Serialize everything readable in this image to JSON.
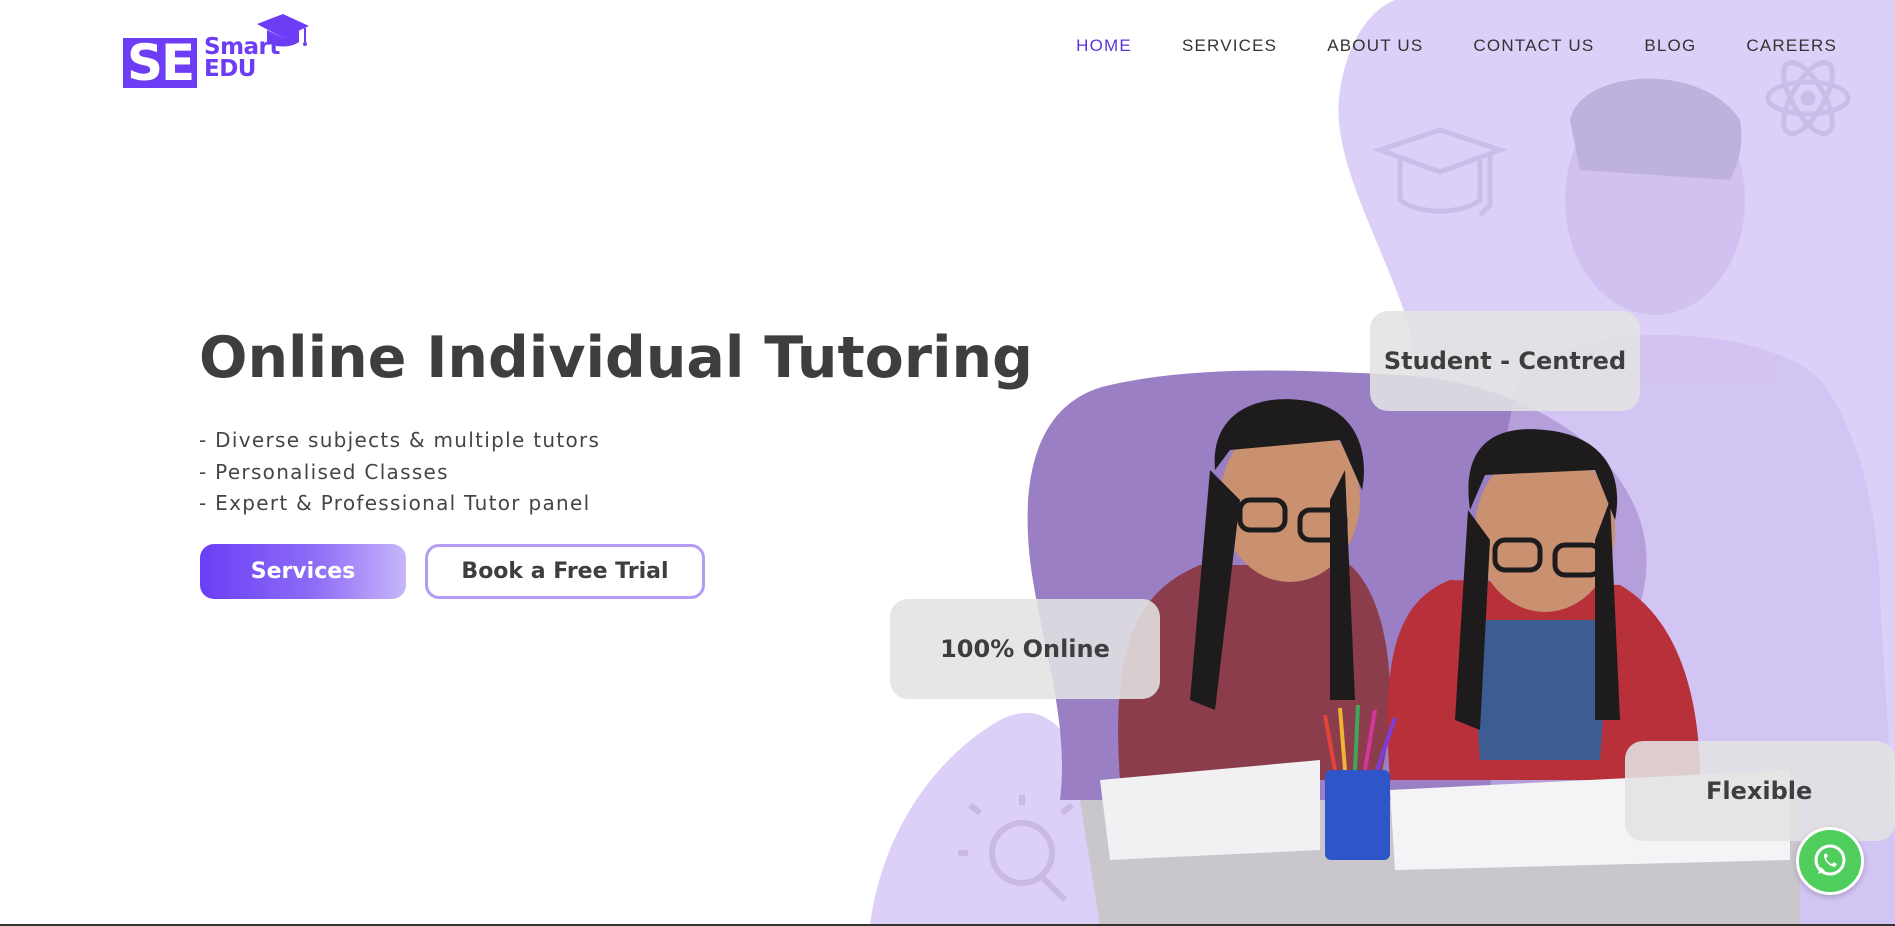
{
  "brand": {
    "logo_mark": "SE",
    "logo_line1": "Smart",
    "logo_line2": "EDU",
    "icon": "graduation-cap-icon",
    "accent_color": "#6d3df5"
  },
  "nav": {
    "items": [
      {
        "label": "HOME",
        "active": true
      },
      {
        "label": "SERVICES",
        "active": false
      },
      {
        "label": "ABOUT US",
        "active": false
      },
      {
        "label": "CONTACT US",
        "active": false
      },
      {
        "label": "BLOG",
        "active": false
      },
      {
        "label": "CAREERS",
        "active": false
      }
    ],
    "active_color": "#5b35d8"
  },
  "hero": {
    "title": "Online Individual Tutoring",
    "bullets": [
      "- Diverse subjects & multiple tutors",
      "- Personalised Classes",
      "- Expert & Professional Tutor panel"
    ],
    "primary_button": "Services",
    "secondary_button": "Book a Free Trial"
  },
  "tags": {
    "student_centred": "Student - Centred",
    "online": "100% Online",
    "flexible": "Flexible"
  },
  "decor_icons": [
    "graduation-cap-icon",
    "atom-icon",
    "lightbulb-icon"
  ],
  "floating": {
    "whatsapp_icon": "whatsapp-icon",
    "whatsapp_color": "#4fce5d"
  },
  "colors": {
    "blob_light": "#dcd0f8",
    "blob_dark": "#9a7fc4"
  }
}
